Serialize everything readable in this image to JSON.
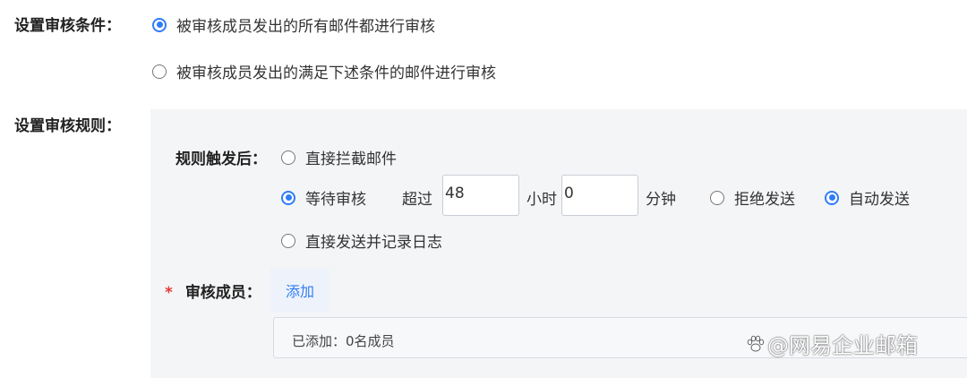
{
  "conditions": {
    "label": "设置审核条件：",
    "options": [
      {
        "label": "被审核成员发出的所有邮件都进行审核",
        "checked": true
      },
      {
        "label": "被审核成员发出的满足下述条件的邮件进行审核",
        "checked": false
      }
    ]
  },
  "rules": {
    "label": "设置审核规则：",
    "trigger_label": "规则触发后：",
    "trigger_options": [
      {
        "label": "直接拦截邮件",
        "checked": false
      },
      {
        "label": "等待审核",
        "checked": true
      },
      {
        "label": "直接发送并记录日志",
        "checked": false
      }
    ],
    "wait": {
      "exceed_label": "超过",
      "hours_value": "48",
      "hours_unit": "小时",
      "minutes_value": "0",
      "minutes_unit": "分钟",
      "actions": [
        {
          "label": "拒绝发送",
          "checked": false
        },
        {
          "label": "自动发送",
          "checked": true
        }
      ]
    },
    "members": {
      "required_mark": "*",
      "label": "审核成员：",
      "add_button": "添加",
      "added_text": "已添加：0名成员"
    }
  },
  "watermark": {
    "text": "@网易企业邮箱",
    "icon": "paw-icon"
  },
  "colors": {
    "accent": "#2f7cf6",
    "panel_bg": "#f4f5f7",
    "required": "#e53935"
  }
}
